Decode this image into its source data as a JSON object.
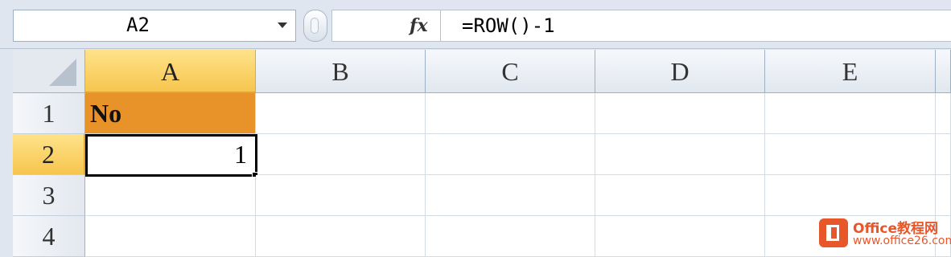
{
  "formula_bar": {
    "name_box": "A2",
    "fx_label": "fx",
    "formula": "=ROW()-1"
  },
  "columns": [
    "A",
    "B",
    "C",
    "D",
    "E"
  ],
  "rows": [
    "1",
    "2",
    "3",
    "4"
  ],
  "cells": {
    "A1": "No",
    "A2": "1"
  },
  "selection": {
    "active_cell": "A2",
    "active_column": "A",
    "active_row": "2"
  },
  "colors": {
    "header_fill": "#e8922a",
    "selected_header": "#f6c54e",
    "watermark": "#e8572a"
  },
  "watermark": {
    "name": "Office教程网",
    "url": "www.office26.com"
  }
}
